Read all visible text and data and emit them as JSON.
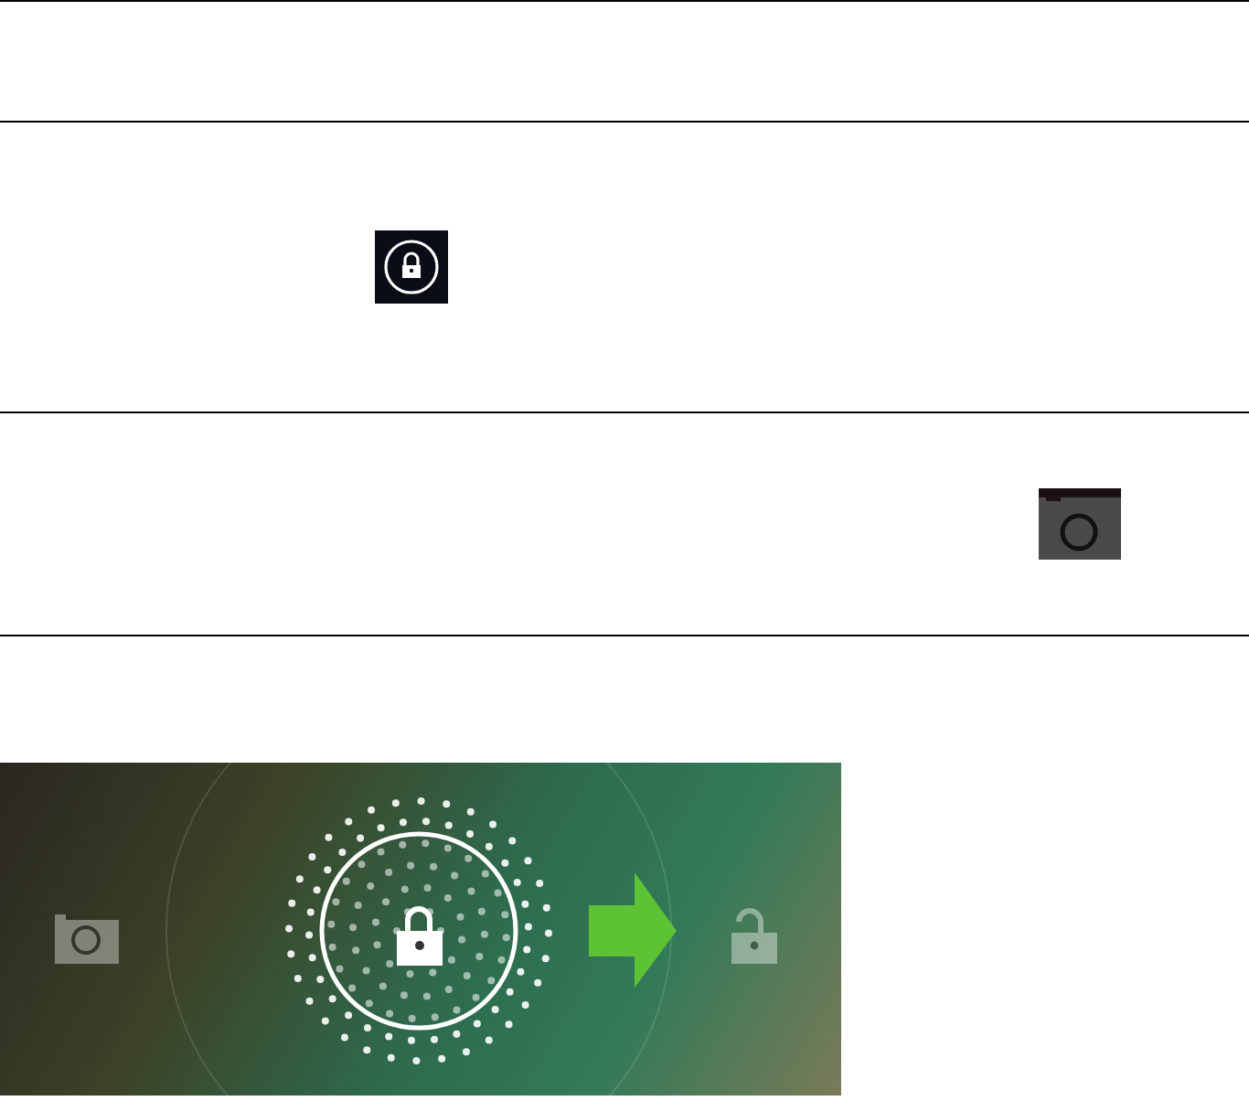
{
  "table": {
    "rows": [
      {
        "kind": "blank"
      },
      {
        "kind": "lock"
      },
      {
        "kind": "camera"
      }
    ]
  },
  "lock_screen": {
    "kind": "unlock-slider"
  }
}
